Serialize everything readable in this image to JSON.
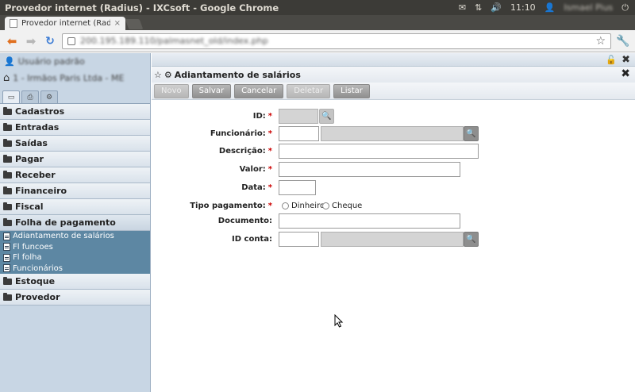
{
  "os": {
    "window_title": "Provedor internet (Radius) - IXCsoft - Google Chrome",
    "clock": "11:10",
    "user": "Ismael Pius"
  },
  "browser": {
    "tab_title": "Provedor internet (Radius",
    "tab_close": "×",
    "url": "200.195.189.110/palmasnet_old/index.php"
  },
  "sidebar": {
    "user": "Usuário padrão",
    "company": "1 - Irmãos Paris Ltda - ME",
    "menu": [
      {
        "label": "Cadastros"
      },
      {
        "label": "Entradas"
      },
      {
        "label": "Saídas"
      },
      {
        "label": "Pagar"
      },
      {
        "label": "Receber"
      },
      {
        "label": "Financeiro"
      },
      {
        "label": "Fiscal"
      },
      {
        "label": "Folha de pagamento"
      }
    ],
    "submenu": [
      {
        "label": "Adiantamento de salários"
      },
      {
        "label": "Fl funcoes"
      },
      {
        "label": "Fl folha"
      },
      {
        "label": "Funcionários"
      }
    ],
    "menu_after": [
      {
        "label": "Estoque"
      },
      {
        "label": "Provedor"
      }
    ]
  },
  "panel": {
    "title": "Adiantamento de salários",
    "buttons": {
      "novo": "Novo",
      "salvar": "Salvar",
      "cancelar": "Cancelar",
      "deletar": "Deletar",
      "listar": "Listar"
    }
  },
  "form": {
    "id_label": "ID:",
    "funcionario_label": "Funcionário:",
    "descricao_label": "Descrição:",
    "valor_label": "Valor:",
    "data_label": "Data:",
    "tipo_label": "Tipo pagamento:",
    "opt_dinheiro": "Dinheiro",
    "opt_cheque": "Cheque",
    "documento_label": "Documento:",
    "id_conta_label": "ID conta:",
    "required_mark": "*"
  }
}
